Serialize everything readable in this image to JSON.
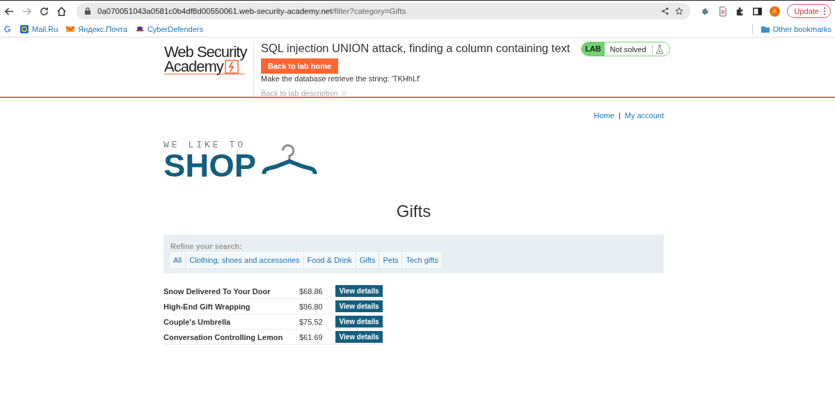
{
  "browser": {
    "url_host": "0a070051043a0581c0b4df8d00550061.web-security-academy.net",
    "url_path": "/filter?category=Gifts",
    "forward_disabled": true,
    "profile_initial": "A",
    "update_label": "Update",
    "bookmarks": [
      {
        "kind": "google"
      },
      {
        "kind": "mailru",
        "label": "Mail.Ru"
      },
      {
        "kind": "yandex",
        "label": "Яндекс.Почта"
      },
      {
        "kind": "cyber",
        "label": "CyberDefenders"
      }
    ],
    "other_bookmarks": "Other bookmarks"
  },
  "lab_header": {
    "logo_line1": "Web Security",
    "logo_line2": "Academy",
    "title": "SQL injection UNION attack, finding a column containing text",
    "back_button": "Back to lab home",
    "description": "Make the database retrieve the string: 'TKHhLf'",
    "back_to_description": "Back to lab description",
    "badge_label": "LAB",
    "status": "Not solved"
  },
  "nav": {
    "links": [
      "Home",
      "My account"
    ],
    "separator": "|"
  },
  "shop_logo": {
    "tagline": "WE LIKE TO",
    "word": "SHOP"
  },
  "heading": "Gifts",
  "filters": {
    "label": "Refine your search:",
    "items": [
      "All",
      "Clothing, shoes and accessories",
      "Food & Drink",
      "Gifts",
      "Pets",
      "Tech gifts"
    ]
  },
  "products": [
    {
      "name": "Snow Delivered To Your Door",
      "price": "$68.86",
      "button": "View details"
    },
    {
      "name": "High-End Gift Wrapping",
      "price": "$96.80",
      "button": "View details"
    },
    {
      "name": "Couple's Umbrella",
      "price": "$75.52",
      "button": "View details"
    },
    {
      "name": "Conversation Controlling Lemon",
      "price": "$61.69",
      "button": "View details"
    }
  ]
}
